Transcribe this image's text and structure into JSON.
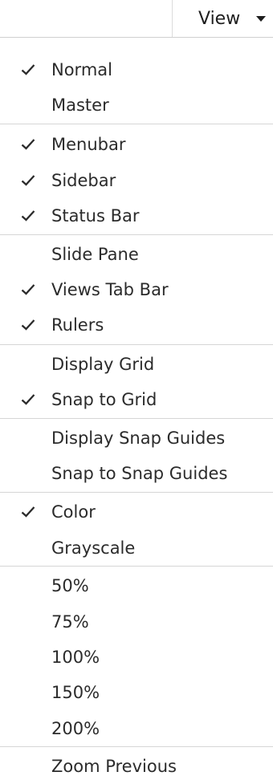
{
  "header": {
    "view_label": "View"
  },
  "menu": {
    "items": [
      {
        "label": "Normal",
        "checked": true
      },
      {
        "label": "Master",
        "checked": false
      },
      {
        "label": "Menubar",
        "checked": true
      },
      {
        "label": "Sidebar",
        "checked": true
      },
      {
        "label": "Status Bar",
        "checked": true
      },
      {
        "label": "Slide Pane",
        "checked": false
      },
      {
        "label": "Views Tab Bar",
        "checked": true
      },
      {
        "label": "Rulers",
        "checked": true
      },
      {
        "label": "Display Grid",
        "checked": false
      },
      {
        "label": "Snap to Grid",
        "checked": true
      },
      {
        "label": "Display Snap Guides",
        "checked": false
      },
      {
        "label": "Snap to Snap Guides",
        "checked": false
      },
      {
        "label": "Color",
        "checked": true
      },
      {
        "label": "Grayscale",
        "checked": false
      },
      {
        "label": "50%",
        "checked": false
      },
      {
        "label": "75%",
        "checked": false
      },
      {
        "label": "100%",
        "checked": false
      },
      {
        "label": "150%",
        "checked": false
      },
      {
        "label": "200%",
        "checked": false
      },
      {
        "label": "Zoom Previous",
        "checked": false
      }
    ]
  },
  "icons": {
    "check": "check-icon",
    "caret": "caret-down-icon"
  },
  "colors": {
    "text": "#2b2b2b",
    "separator": "#d6d6d6"
  }
}
